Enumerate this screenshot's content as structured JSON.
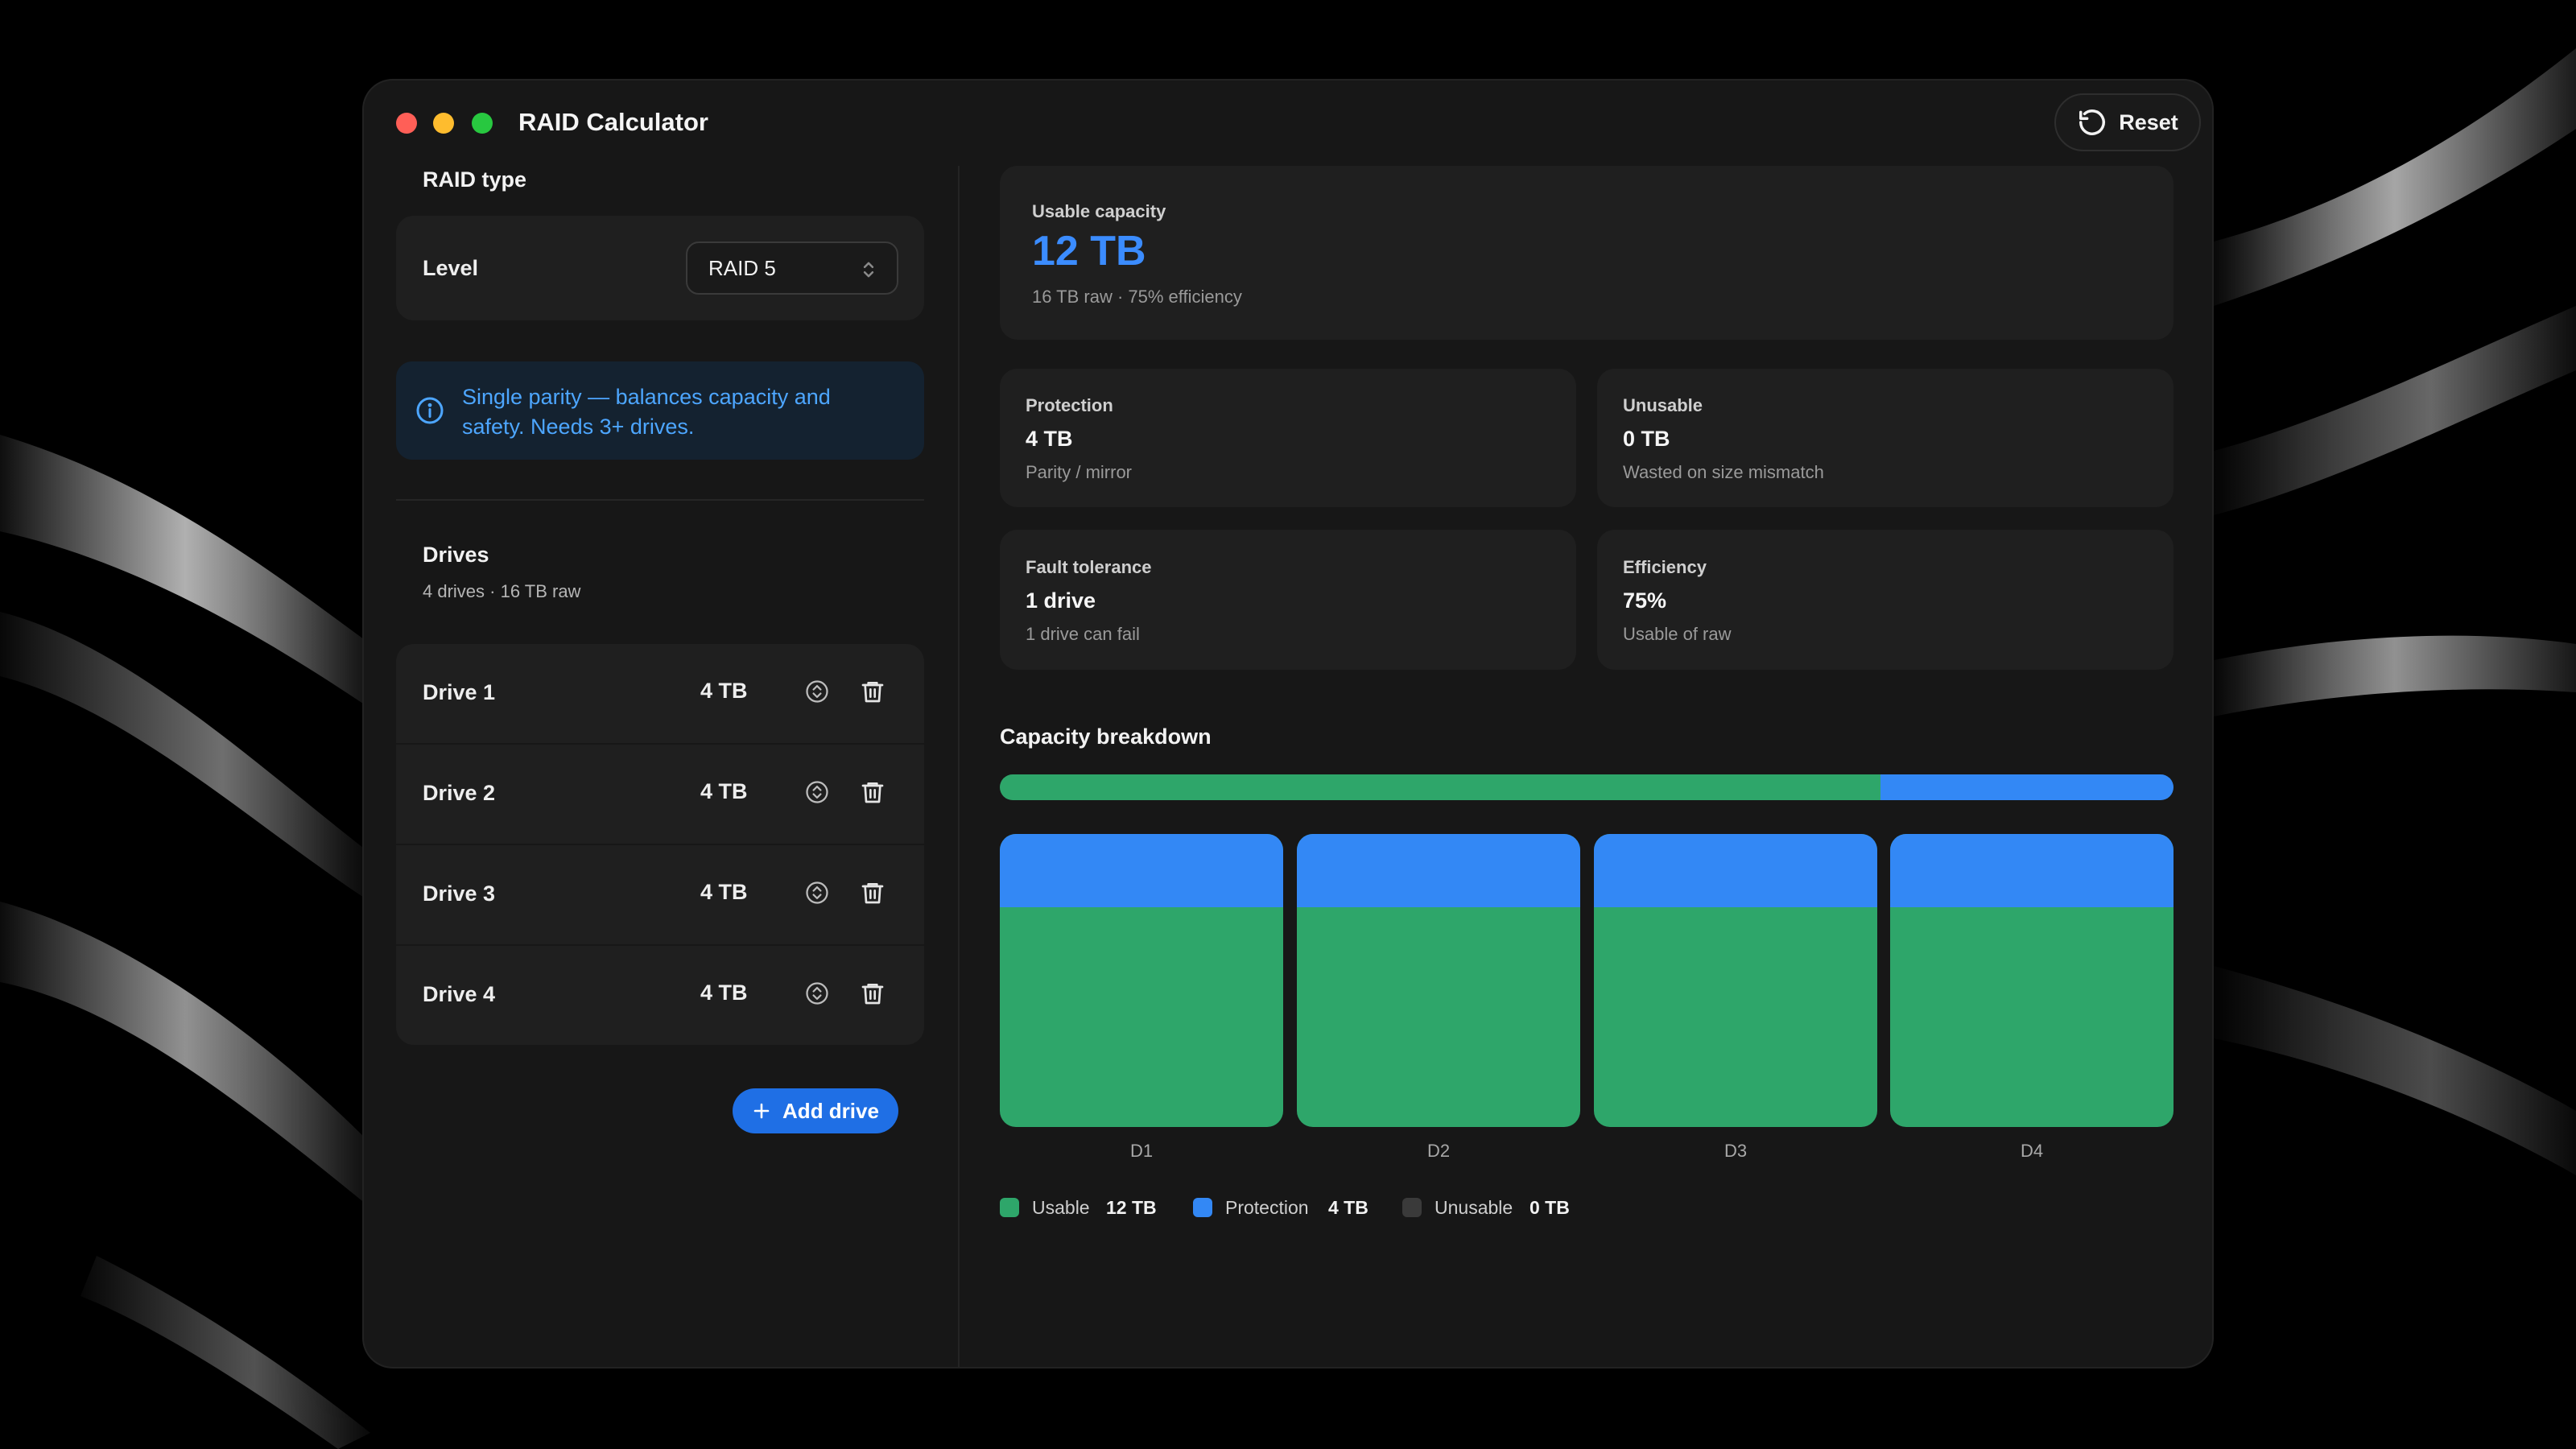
{
  "window": {
    "title": "RAID Calculator",
    "reset_label": "Reset"
  },
  "raid_type": {
    "section_title": "RAID type",
    "level_label": "Level",
    "level_value": "RAID 5",
    "info": "Single parity — balances capacity and safety. Needs 3+ drives."
  },
  "drives": {
    "section_title": "Drives",
    "summary": "4 drives · 16 TB raw",
    "items": [
      {
        "name": "Drive 1",
        "size": "4 TB"
      },
      {
        "name": "Drive 2",
        "size": "4 TB"
      },
      {
        "name": "Drive 3",
        "size": "4 TB"
      },
      {
        "name": "Drive 4",
        "size": "4 TB"
      }
    ],
    "add_label": "Add drive"
  },
  "summary": {
    "usable": {
      "label": "Usable capacity",
      "value": "12 TB",
      "sub": "16 TB raw · 75% efficiency"
    },
    "protection": {
      "label": "Protection",
      "value": "4 TB",
      "sub": "Parity / mirror"
    },
    "unusable": {
      "label": "Unusable",
      "value": "0 TB",
      "sub": "Wasted on size mismatch"
    },
    "fault": {
      "label": "Fault tolerance",
      "value": "1 drive",
      "sub": "1 drive can fail"
    },
    "efficiency": {
      "label": "Efficiency",
      "value": "75%",
      "sub": "Usable of raw"
    }
  },
  "breakdown": {
    "title": "Capacity breakdown",
    "legend": [
      {
        "name": "Usable",
        "value": "12 TB",
        "color": "#2ea66a"
      },
      {
        "name": "Protection",
        "value": "4 TB",
        "color": "#3388f5"
      },
      {
        "name": "Unusable",
        "value": "0 TB",
        "color": "#3a3a3a"
      }
    ]
  },
  "chart_data": {
    "type": "bar",
    "categories": [
      "D1",
      "D2",
      "D3",
      "D4"
    ],
    "series": [
      {
        "name": "Usable",
        "values": [
          3,
          3,
          3,
          3
        ],
        "color": "#2ea66a"
      },
      {
        "name": "Protection",
        "values": [
          1,
          1,
          1,
          1
        ],
        "color": "#3388f5"
      },
      {
        "name": "Unusable",
        "values": [
          0,
          0,
          0,
          0
        ],
        "color": "#3a3a3a"
      }
    ],
    "totals": {
      "usable": 12,
      "protection": 4,
      "unusable": 0
    },
    "unit": "TB"
  }
}
